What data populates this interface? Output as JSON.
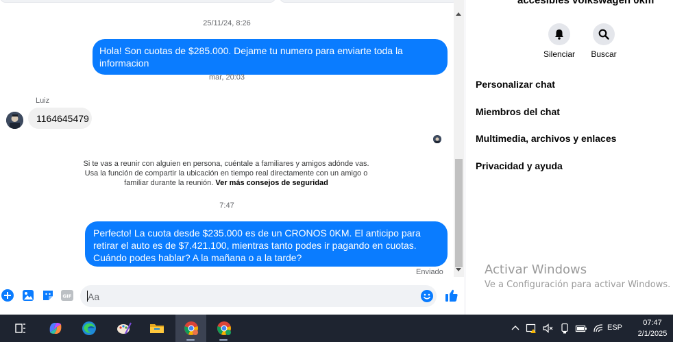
{
  "chat": {
    "messages": {
      "ts1": "25/11/24, 8:26",
      "out1": "Hola! Son cuotas de $285.000. Dejame tu numero para enviarte toda la informacion",
      "ts2": "mar, 20:03",
      "sender": "Luiz",
      "in1": "1164645479",
      "safety_text": "Si te vas a reunir con alguien en persona, cuéntale a familiares y amigos adónde vas. Usa la función de compartir la ubicación en tiempo real directamente con un amigo o familiar durante la reunión.",
      "safety_link": "Ver más consejos de seguridad",
      "ts3": "7:47",
      "out2": "Perfecto! La cuota desde $235.000 es de un CRONOS 0KM. El anticipo para retirar el auto es de $7.421.100, mientras tanto podes ir pagando en cuotas. Cuándo podes hablar? A la mañana o a la tarde?",
      "status": "Enviado"
    },
    "composer": {
      "placeholder": "Aa",
      "gif_label": "GIF"
    }
  },
  "panel": {
    "title": "accesibles volkswagen 0km",
    "actions": [
      {
        "label": "Silenciar",
        "icon": "bell-icon"
      },
      {
        "label": "Buscar",
        "icon": "search-icon"
      }
    ],
    "menu": [
      "Personalizar chat",
      "Miembros del chat",
      "Multimedia, archivos y enlaces",
      "Privacidad y ayuda"
    ],
    "watermark": {
      "title": "Activar Windows",
      "subtitle": "Ve a Configuración para activar Windows."
    }
  },
  "taskbar": {
    "apps": [
      "task-view-icon",
      "copilot-icon",
      "edge-icon",
      "paint-icon",
      "file-explorer-icon",
      "chrome-icon",
      "chrome-profile-icon"
    ],
    "language": "ESP",
    "time": "07:47",
    "date": "2/1/2025"
  },
  "colors": {
    "accent": "#0a7cff",
    "bubble_in": "#f0f0f0",
    "taskbar": "#1e2430"
  }
}
